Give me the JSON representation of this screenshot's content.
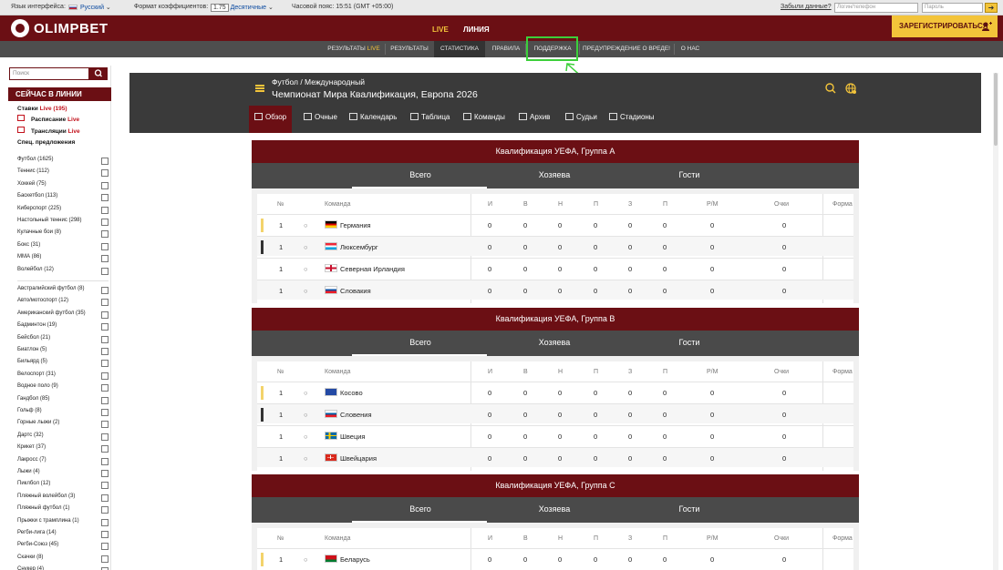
{
  "topbar": {
    "lang_label": "Язык интерфейса:",
    "lang_value": "Русский",
    "coef_label": "Формат коэффициентов:",
    "coef_box": "1.75",
    "coef_value": "Десятичные",
    "tz_label": "Часовой пояс: 15:51 (GMT +05:00)",
    "forgot": "Забыли данные?",
    "login_placeholder": "Логин/телефон",
    "password_placeholder": "Пароль"
  },
  "header": {
    "logo": "OLIMPBET",
    "live": "LIVE",
    "line": "ЛИНИЯ",
    "register": "ЗАРЕГИСТРИРОВАТЬСЯ"
  },
  "nav": {
    "tabs": [
      {
        "label": "РЕЗУЛЬТАТЫ",
        "hl": "LIVE"
      },
      {
        "label": "РЕЗУЛЬТАТЫ",
        "hl": ""
      },
      {
        "label": "СТАТИСТИКА",
        "hl": ""
      },
      {
        "label": "ПРАВИЛА",
        "hl": ""
      },
      {
        "label": "ПОДДЕРЖКА",
        "hl": ""
      },
      {
        "label": "ПРЕДУПРЕЖДЕНИЕ О ВРЕДЕ!",
        "hl": ""
      },
      {
        "label": "О НАС",
        "hl": ""
      }
    ]
  },
  "sidebar": {
    "search_placeholder": "Поиск",
    "section_title": "СЕЙЧАС В ЛИНИИ",
    "quick": [
      {
        "label": "Ставки",
        "live": "Live (195)"
      },
      {
        "label": "Расписание",
        "live": "Live"
      },
      {
        "label": "Трансляции",
        "live": "Live"
      },
      {
        "label": "Спец. предложения",
        "live": ""
      }
    ],
    "sports_top": [
      "Футбол (1625)",
      "Теннис (112)",
      "Хоккей (75)",
      "Баскетбол (113)",
      "Киберспорт (225)",
      "Настольный теннис (298)",
      "Кулачные бои (8)",
      "Бокс (31)",
      "ММА (86)",
      "Волейбол (12)"
    ],
    "sports_more": [
      "Австралийский футбол (8)",
      "Авто/мотоспорт (12)",
      "Американский футбол (35)",
      "Бадминтон (19)",
      "Бейсбол (21)",
      "Биатлон (5)",
      "Бильярд (5)",
      "Велоспорт (31)",
      "Водное поло (9)",
      "Гандбол (85)",
      "Гольф (8)",
      "Горные лыжи (2)",
      "Дартс (32)",
      "Крикет (37)",
      "Лакросс (7)",
      "Лыжи (4)",
      "Пиклбол (12)",
      "Пляжный волейбол (3)",
      "Пляжный футбол (1)",
      "Прыжки с трамплина (1)",
      "Регби-лига (14)",
      "Регби-Союз (45)",
      "Скачки (8)",
      "Снукер (4)"
    ]
  },
  "content": {
    "breadcrumb": "Футбол / Международный",
    "title": "Чемпионат Мира Квалификация, Европа 2026",
    "subnav": [
      "Обзор",
      "Очные",
      "Календарь",
      "Таблица",
      "Команды",
      "Архив",
      "Судьи",
      "Стадионы"
    ]
  },
  "table_headers": [
    "№",
    "Команда",
    "И",
    "В",
    "Н",
    "П",
    "З",
    "П",
    "Р/М",
    "Очки",
    "Форма"
  ],
  "group_tabs": [
    "Всего",
    "Хозяева",
    "Гости"
  ],
  "groups": [
    {
      "title": "Квалификация УЕФА, Группа A",
      "rows": [
        {
          "pos": "1",
          "mark": "○",
          "team": "Германия",
          "flag": "de",
          "bar": "#f3d36b",
          "stats": [
            "0",
            "0",
            "0",
            "0",
            "0",
            "0",
            "0",
            "0"
          ]
        },
        {
          "pos": "1",
          "mark": "○",
          "team": "Люксембург",
          "flag": "lu",
          "bar": "#333333",
          "stats": [
            "0",
            "0",
            "0",
            "0",
            "0",
            "0",
            "0",
            "0"
          ]
        },
        {
          "pos": "1",
          "mark": "○",
          "team": "Северная Ирландия",
          "flag": "ni",
          "bar": "",
          "stats": [
            "0",
            "0",
            "0",
            "0",
            "0",
            "0",
            "0",
            "0"
          ]
        },
        {
          "pos": "1",
          "mark": "○",
          "team": "Словакия",
          "flag": "sk",
          "bar": "",
          "stats": [
            "0",
            "0",
            "0",
            "0",
            "0",
            "0",
            "0",
            "0"
          ]
        }
      ]
    },
    {
      "title": "Квалификация УЕФА, Группа B",
      "rows": [
        {
          "pos": "1",
          "mark": "○",
          "team": "Косово",
          "flag": "xk",
          "bar": "#f3d36b",
          "stats": [
            "0",
            "0",
            "0",
            "0",
            "0",
            "0",
            "0",
            "0"
          ]
        },
        {
          "pos": "1",
          "mark": "○",
          "team": "Словения",
          "flag": "si",
          "bar": "#333333",
          "stats": [
            "0",
            "0",
            "0",
            "0",
            "0",
            "0",
            "0",
            "0"
          ]
        },
        {
          "pos": "1",
          "mark": "○",
          "team": "Швеция",
          "flag": "se",
          "bar": "",
          "stats": [
            "0",
            "0",
            "0",
            "0",
            "0",
            "0",
            "0",
            "0"
          ]
        },
        {
          "pos": "1",
          "mark": "○",
          "team": "Швейцария",
          "flag": "ch",
          "bar": "",
          "stats": [
            "0",
            "0",
            "0",
            "0",
            "0",
            "0",
            "0",
            "0"
          ]
        }
      ]
    },
    {
      "title": "Квалификация УЕФА, Группа C",
      "rows": [
        {
          "pos": "1",
          "mark": "○",
          "team": "Беларусь",
          "flag": "by",
          "bar": "#f3d36b",
          "stats": [
            "0",
            "0",
            "0",
            "0",
            "0",
            "0",
            "0",
            "0"
          ]
        }
      ]
    }
  ],
  "colors": {
    "brand": "#6b0f14",
    "accent": "#f3c43a",
    "highlight": "#3ccf3a"
  }
}
